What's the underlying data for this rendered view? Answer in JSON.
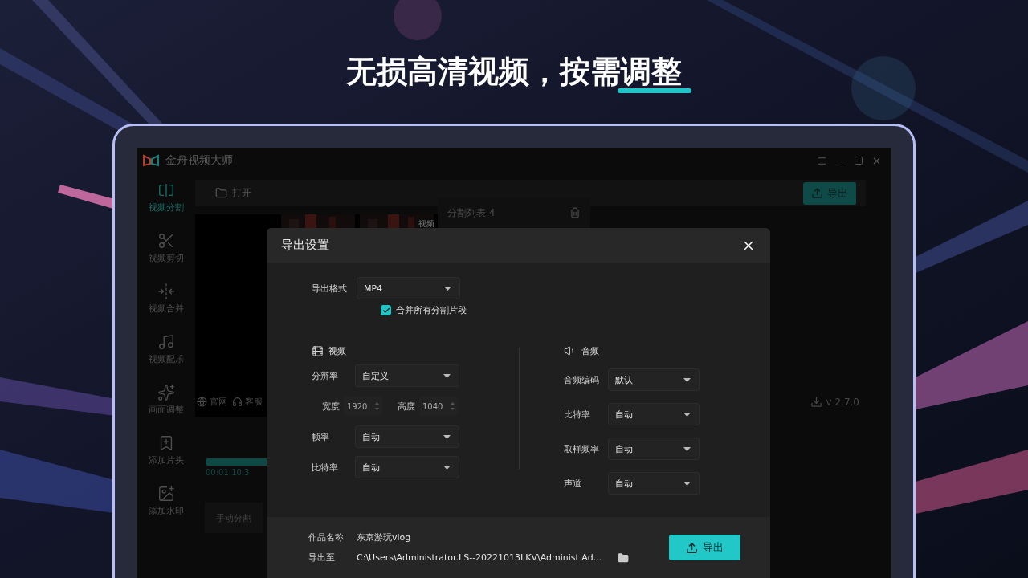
{
  "headline": "无损高清视频，按需调整",
  "app": {
    "title": "金舟视频大师",
    "sidebar": [
      {
        "kind": "split",
        "label": "视频分割",
        "selected": true
      },
      {
        "kind": "cut",
        "label": "视频剪切",
        "selected": false
      },
      {
        "kind": "merge",
        "label": "视频合并",
        "selected": false
      },
      {
        "kind": "music",
        "label": "视频配乐",
        "selected": false
      },
      {
        "kind": "adjust",
        "label": "画面调整",
        "selected": false
      },
      {
        "kind": "intro",
        "label": "添加片头",
        "selected": false
      },
      {
        "kind": "watermark",
        "label": "添加水印",
        "selected": false
      }
    ],
    "open_button": "打开",
    "export_button": "导出",
    "segment_list": "分割列表 4",
    "thumb_label": "视频",
    "links": [
      {
        "kind": "web",
        "label": "官网"
      },
      {
        "kind": "support",
        "label": "客服"
      }
    ],
    "time": "00:01:10.3",
    "manual_split": "手动分割",
    "version": "v 2.7.0"
  },
  "dialog": {
    "title": "导出设置",
    "format": {
      "label": "导出格式",
      "value": "MP4"
    },
    "merge": {
      "label": "合并所有分割片段",
      "checked": true
    },
    "video": {
      "title": "视频",
      "fields": [
        {
          "kind": "select",
          "label": "分辨率",
          "value": "自定义"
        },
        {
          "kind": "size",
          "items": [
            {
              "label": "宽度",
              "value": "1920"
            },
            {
              "label": "高度",
              "value": "1040"
            }
          ]
        },
        {
          "kind": "select",
          "label": "帧率",
          "value": "自动"
        },
        {
          "kind": "select",
          "label": "比特率",
          "value": "自动"
        }
      ]
    },
    "audio": {
      "title": "音频",
      "fields": [
        {
          "kind": "select",
          "label": "音频编码",
          "value": "默认"
        },
        {
          "kind": "select",
          "label": "比特率",
          "value": "自动"
        },
        {
          "kind": "select",
          "label": "取样频率",
          "value": "自动"
        },
        {
          "kind": "select",
          "label": "声道",
          "value": "自动"
        }
      ]
    },
    "name": {
      "label": "作品名称",
      "value": "东京游玩vlog"
    },
    "path": {
      "label": "导出至",
      "value": "C:\\Users\\Administrator.LS--20221013LKV\\Administ Ad..."
    },
    "export_button": "导出"
  }
}
